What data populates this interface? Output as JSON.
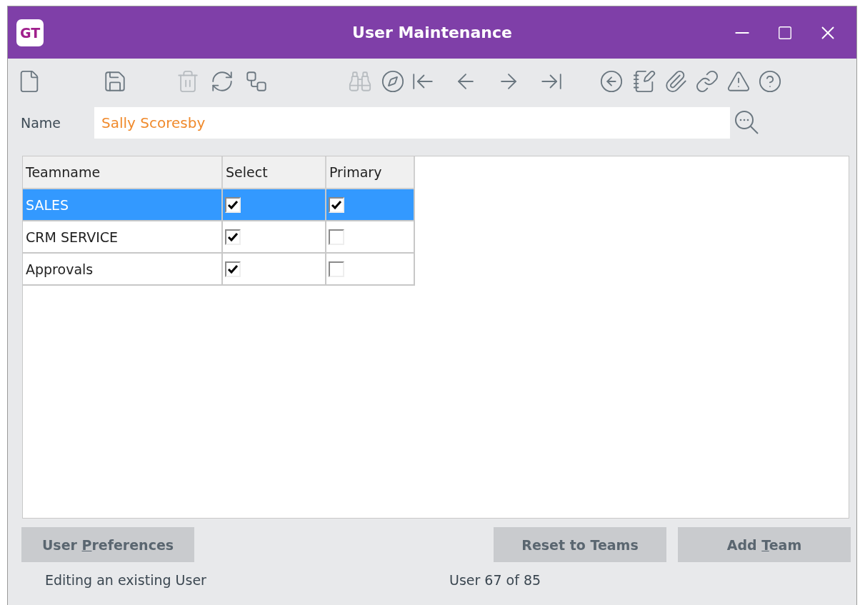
{
  "window": {
    "logo": "GT",
    "title": "User Maintenance"
  },
  "toolbar": [
    {
      "kind": "new",
      "disabled": false
    },
    {
      "kind": "save",
      "disabled": false
    },
    {
      "kind": "delete",
      "disabled": true
    },
    {
      "kind": "refresh",
      "disabled": false
    },
    {
      "kind": "workflow",
      "disabled": false
    },
    {
      "kind": "find",
      "disabled": true
    },
    {
      "kind": "compass",
      "disabled": false
    },
    {
      "kind": "first",
      "disabled": false
    },
    {
      "kind": "previous",
      "disabled": false
    },
    {
      "kind": "next",
      "disabled": false
    },
    {
      "kind": "last",
      "disabled": false
    },
    {
      "kind": "back",
      "disabled": false
    },
    {
      "kind": "notes",
      "disabled": false
    },
    {
      "kind": "attach",
      "disabled": false
    },
    {
      "kind": "link",
      "disabled": false
    },
    {
      "kind": "alert",
      "disabled": false
    },
    {
      "kind": "help",
      "disabled": false
    }
  ],
  "name_field": {
    "label": "Name",
    "value": "Sally Scoresby"
  },
  "table": {
    "columns": [
      "Teamname",
      "Select",
      "Primary"
    ],
    "rows": [
      {
        "teamname": "SALES",
        "select": true,
        "primary": true,
        "selected": true
      },
      {
        "teamname": "CRM SERVICE",
        "select": true,
        "primary": false,
        "selected": false
      },
      {
        "teamname": "Approvals",
        "select": true,
        "primary": false,
        "selected": false
      }
    ]
  },
  "left_buttons": [
    {
      "before": "User ",
      "key": "P",
      "after": "references"
    }
  ],
  "right_buttons": [
    {
      "before": "Reset to Teams"
    },
    {
      "before": "Add ",
      "key": "T",
      "after": "eam"
    }
  ],
  "status_bar": {
    "message": "Editing an existing User",
    "position": "User 67 of 85"
  }
}
